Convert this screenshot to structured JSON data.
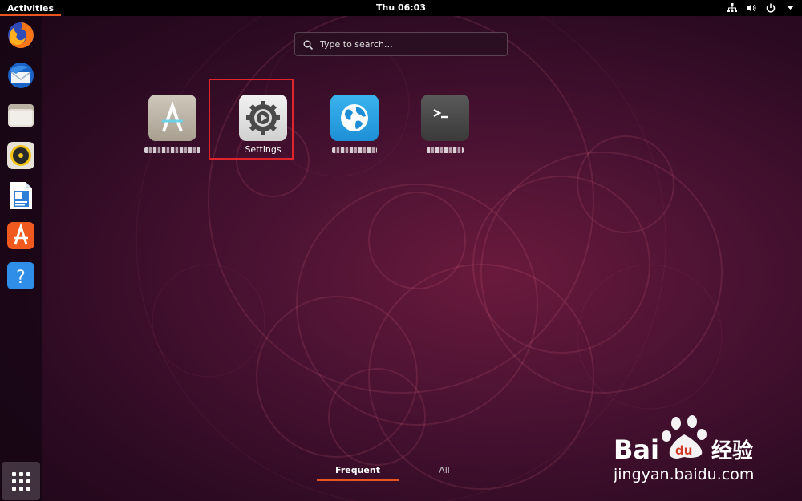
{
  "topbar": {
    "activities_label": "Activities",
    "clock": "Thu 06:03",
    "tray_icons": [
      "network-icon",
      "volume-icon",
      "power-icon",
      "chevron-down-icon"
    ]
  },
  "dock": {
    "items": [
      {
        "icon": "firefox-icon"
      },
      {
        "icon": "thunderbird-icon"
      },
      {
        "icon": "files-icon"
      },
      {
        "icon": "rhythmbox-icon"
      },
      {
        "icon": "libreoffice-writer-icon"
      },
      {
        "icon": "ubuntu-software-icon"
      },
      {
        "icon": "help-icon"
      }
    ],
    "show_applications_icon": "grid-icon"
  },
  "search": {
    "placeholder": "Type to search…"
  },
  "apps": [
    {
      "icon": "software-updater-icon",
      "label": "",
      "label_obscured": true
    },
    {
      "icon": "settings-icon",
      "label": "Settings",
      "label_obscured": false,
      "highlighted": true
    },
    {
      "icon": "web-browser-icon",
      "label": "",
      "label_obscured": true
    },
    {
      "icon": "terminal-icon",
      "label": "",
      "label_obscured": true
    }
  ],
  "view_tabs": {
    "frequent": "Frequent",
    "all": "All",
    "active": "frequent"
  },
  "watermark": {
    "brand_left": "Bai",
    "brand_right": "经验",
    "url": "jingyan.baidu.com"
  },
  "colors": {
    "accent": "#e95420",
    "highlight_box": "#e0252a",
    "topbar": "#000000"
  }
}
